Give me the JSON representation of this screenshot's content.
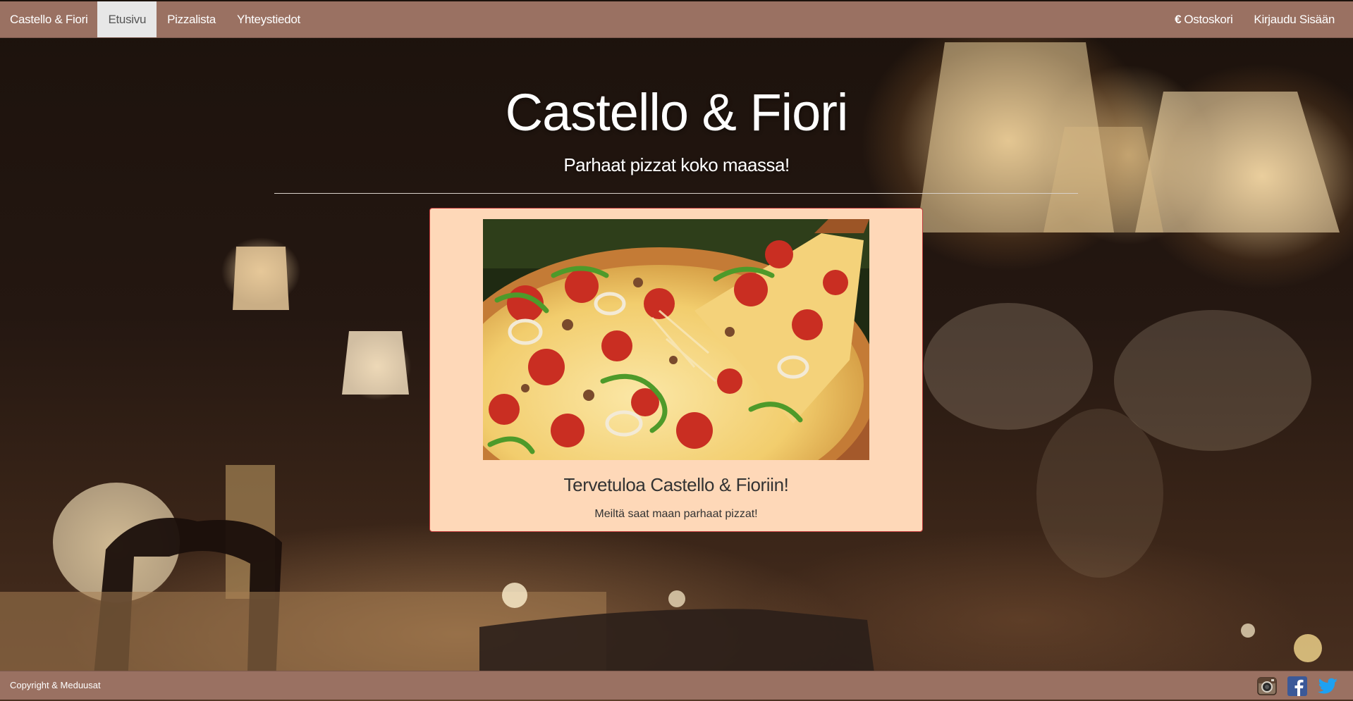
{
  "navbar": {
    "brand": "Castello & Fiori",
    "items": [
      {
        "label": "Etusivu",
        "active": true
      },
      {
        "label": "Pizzalista",
        "active": false
      },
      {
        "label": "Yhteystiedot",
        "active": false
      }
    ],
    "right": {
      "cart_icon": "euro-icon",
      "cart_symbol": "€",
      "cart_label": "Ostoskori",
      "login_label": "Kirjaudu Sisään"
    }
  },
  "hero": {
    "title": "Castello & Fiori",
    "subtitle": "Parhaat pizzat koko maassa!"
  },
  "card": {
    "image": "pizza-photo",
    "title": "Tervetuloa Castello & Fioriin!",
    "text": "Meiltä saat maan parhaat pizzat!"
  },
  "footer": {
    "copyright": "Copyright & Meduusat",
    "social": [
      "instagram-icon",
      "facebook-icon",
      "twitter-icon"
    ]
  },
  "colors": {
    "nav_bg": "#9a7162",
    "active_tab_bg": "#e7e7e7",
    "card_bg": "#fed8b8",
    "card_border": "#c23a3a",
    "facebook": "#3b5998",
    "twitter": "#1da1f2"
  }
}
